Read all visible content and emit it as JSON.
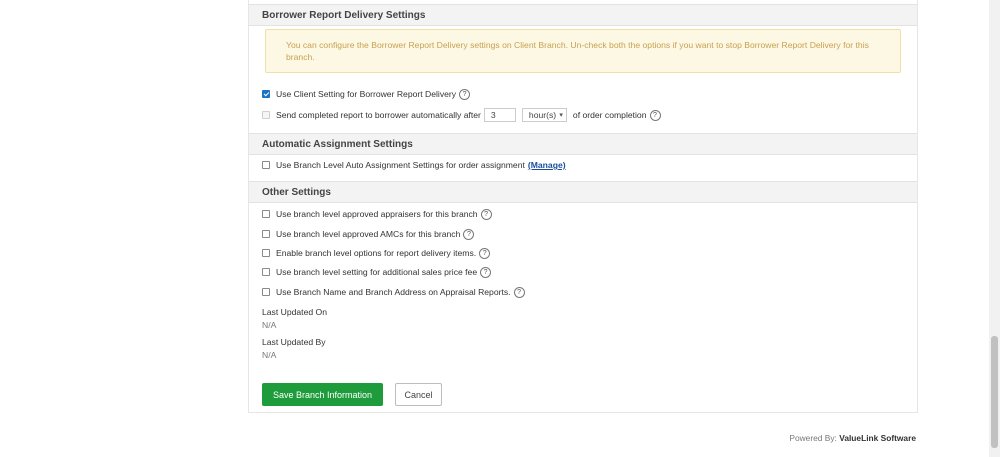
{
  "borrower_section": {
    "title": "Borrower Report Delivery Settings",
    "notice": "You can configure the Borrower Report Delivery settings on Client Branch. Un-check both the options if you want to stop Borrower Report Delivery for this branch.",
    "use_client_setting_label": "Use Client Setting for Borrower Report Delivery",
    "use_client_setting_checked": true,
    "send_report_label_prefix": "Send completed report to borrower automatically after",
    "send_report_value": "3",
    "send_report_unit": "hour(s)",
    "send_report_label_suffix": "of order completion",
    "send_report_checked": false
  },
  "auto_assign_section": {
    "title": "Automatic Assignment Settings",
    "branch_level_label": "Use Branch Level Auto Assignment Settings for order assignment",
    "manage_link": "(Manage)",
    "branch_level_checked": false
  },
  "other_section": {
    "title": "Other Settings",
    "options": [
      {
        "label": "Use branch level approved appraisers for this branch",
        "checked": false
      },
      {
        "label": "Use branch level approved AMCs for this branch",
        "checked": false
      },
      {
        "label": "Enable branch level options for report delivery items.",
        "checked": false
      },
      {
        "label": "Use branch level setting for additional sales price fee",
        "checked": false
      },
      {
        "label": "Use Branch Name and Branch Address on Appraisal Reports.",
        "checked": false
      }
    ],
    "last_updated_on_label": "Last Updated On",
    "last_updated_on_value": "N/A",
    "last_updated_by_label": "Last Updated By",
    "last_updated_by_value": "N/A"
  },
  "actions": {
    "save_label": "Save Branch Information",
    "cancel_label": "Cancel"
  },
  "footer": {
    "powered_by": "Powered By:",
    "brand": "ValueLink Software"
  },
  "help_glyph": "?",
  "chevron_glyph": "▾"
}
